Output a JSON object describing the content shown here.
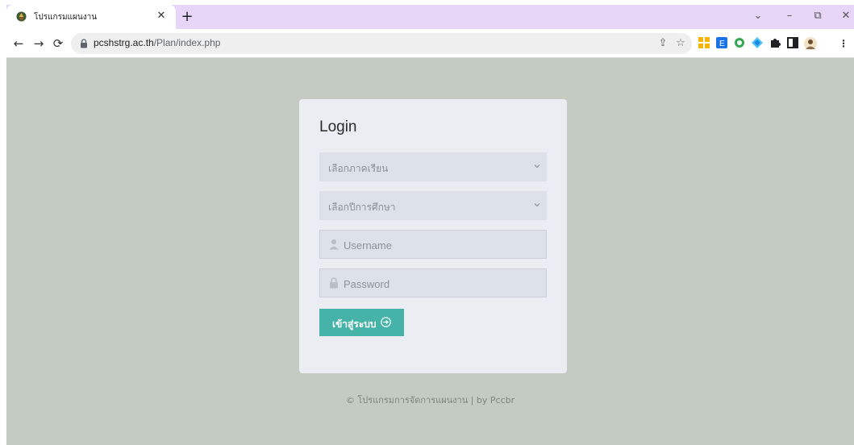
{
  "browser": {
    "tab_title": "โปรแกรมแผนงาน",
    "url_domain": "pcshstrg.ac.th",
    "url_path": "/Plan/index.php",
    "accent_tabstrip": "#e7d6f7"
  },
  "login": {
    "title": "Login",
    "semester_select": "เลือกภาคเรียน",
    "year_select": "เลือกปีการศึกษา",
    "username_placeholder": "Username",
    "password_placeholder": "Password",
    "submit_label": "เข้าสู่ระบบ",
    "submit_color": "#45b3a8"
  },
  "footer": {
    "text": "© โปรแกรมการจัดการแผนงาน | by Pccbr"
  },
  "icons": {
    "favicon": "school-logo-icon",
    "lock": "lock-icon",
    "user": "user-icon",
    "password": "lock-icon",
    "submit": "arrow-circle-right-icon"
  }
}
